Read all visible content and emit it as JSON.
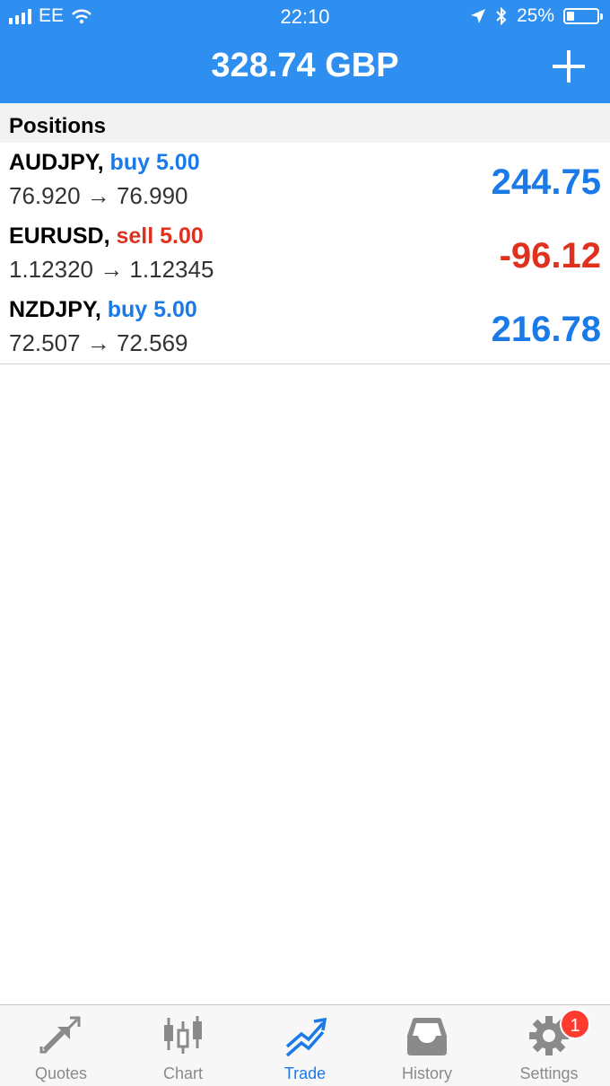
{
  "status_bar": {
    "carrier": "EE",
    "time": "22:10",
    "battery": "25%"
  },
  "header": {
    "balance": "328.74 GBP"
  },
  "section_title": "Positions",
  "positions": [
    {
      "symbol": "AUDJPY,",
      "side": "buy 5.00",
      "prices": "76.920 → 76.990",
      "profit": "244.75"
    },
    {
      "symbol": "EURUSD,",
      "side": "sell 5.00",
      "prices": "1.12320 → 1.12345",
      "profit": "-96.12"
    },
    {
      "symbol": "NZDJPY,",
      "side": "buy 5.00",
      "prices": "72.507 → 72.569",
      "profit": "216.78"
    }
  ],
  "tabs": [
    {
      "label": "Quotes",
      "icon": "quotes-icon"
    },
    {
      "label": "Chart",
      "icon": "chart-icon"
    },
    {
      "label": "Trade",
      "icon": "trade-icon",
      "active": true
    },
    {
      "label": "History",
      "icon": "history-icon"
    },
    {
      "label": "Settings",
      "icon": "gear-icon"
    }
  ],
  "settings_badge": "1",
  "colors": {
    "accent": "#2f8ff0",
    "profit": "#1a7ae8",
    "loss": "#e0301e"
  }
}
